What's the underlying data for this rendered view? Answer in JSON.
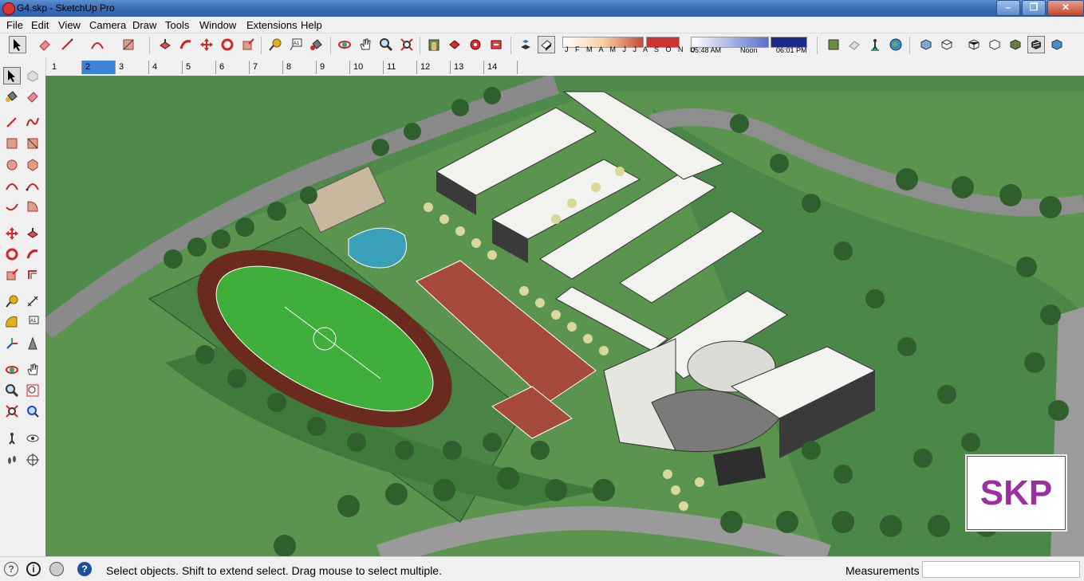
{
  "window": {
    "title": "G4.skp - SketchUp Pro",
    "app_icon": "sketchup-icon"
  },
  "menu": [
    "File",
    "Edit",
    "View",
    "Camera",
    "Draw",
    "Tools",
    "Window",
    "Extensions",
    "Help"
  ],
  "shadows": {
    "months": "J F M A M J J A S O N D",
    "time_start": "05:48 AM",
    "time_mid": "Noon",
    "time_end": "06:01 PM"
  },
  "scene_tabs": [
    "1",
    "2",
    "3",
    "4",
    "5",
    "6",
    "7",
    "8",
    "9",
    "10",
    "11",
    "12",
    "13",
    "14"
  ],
  "active_scene": "2",
  "logo": {
    "text": "SKP",
    "color": "#9b2fa0"
  },
  "status": {
    "message": "Select objects. Shift to extend select. Drag mouse to select multiple.",
    "measurements_label": "Measurements",
    "measurements_value": ""
  },
  "colors": {
    "accent": "#3a85d8",
    "titlebar": "#3c6fb5",
    "grass": "#4f8a4c",
    "field": "#3fae3a",
    "track": "#6b2a1e",
    "courts": "#a64a3c"
  }
}
